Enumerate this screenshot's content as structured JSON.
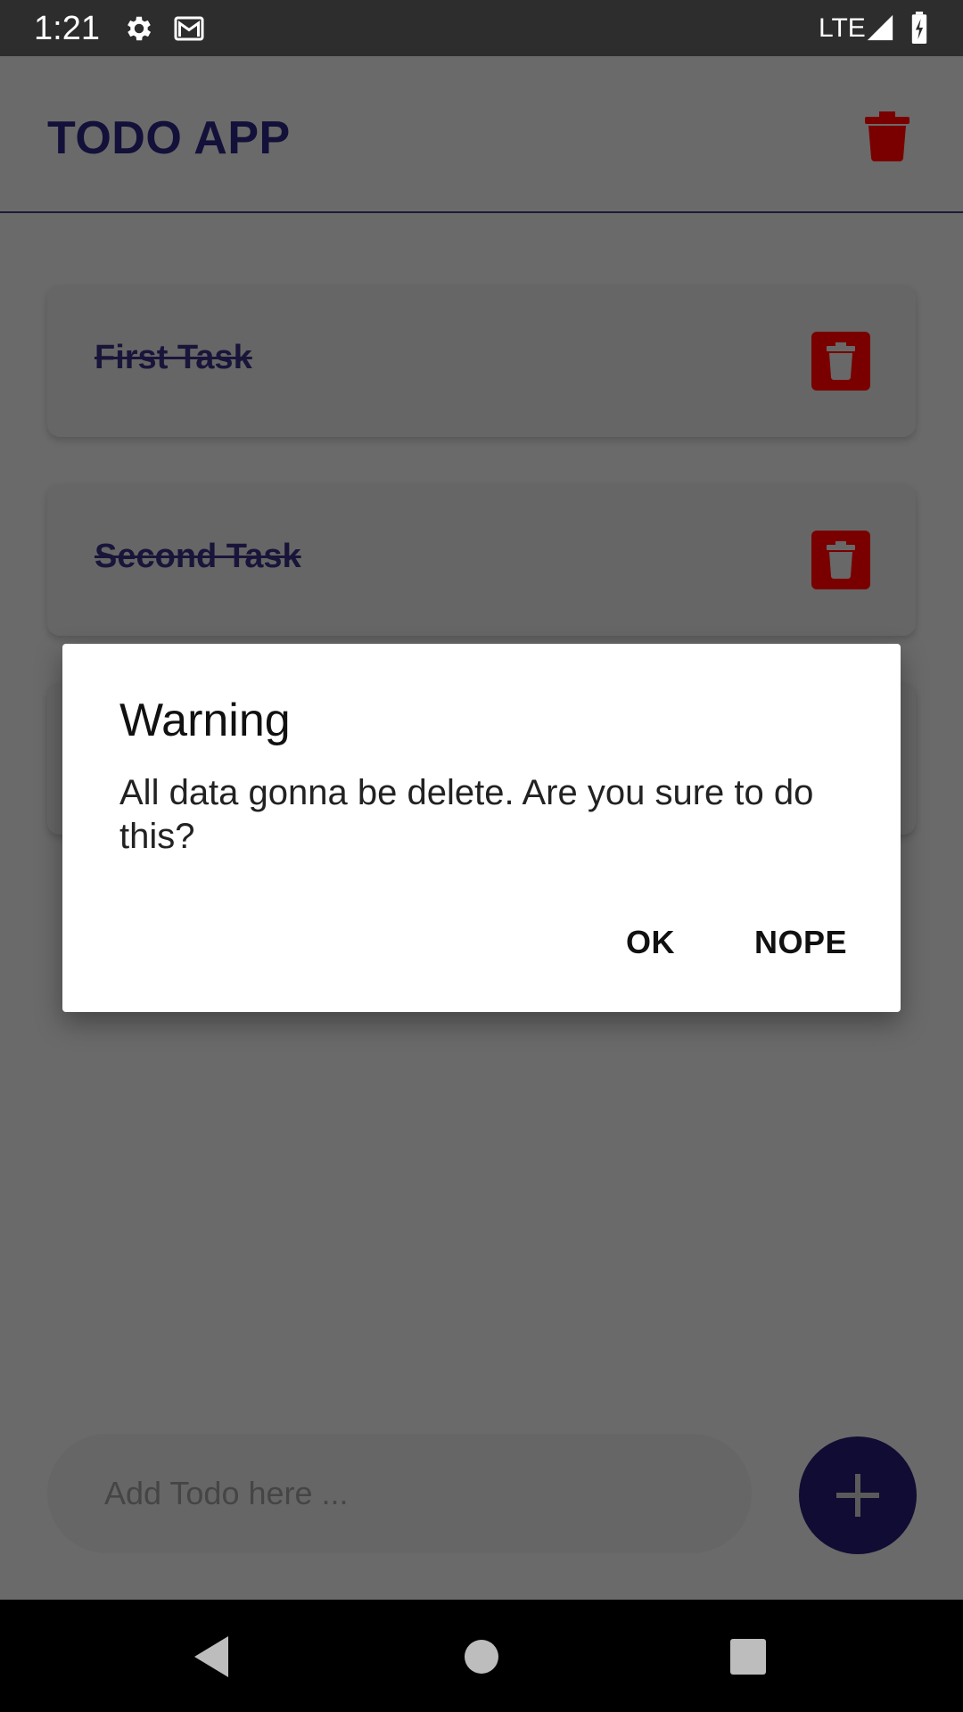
{
  "status_bar": {
    "time": "1:21",
    "network": "LTE",
    "icons": [
      "gear-icon",
      "mail-icon",
      "signal-icon",
      "battery-charging-icon"
    ]
  },
  "app": {
    "title": "TODO APP",
    "header_action_icon": "trash-icon",
    "accent_color": "#13103a",
    "delete_color": "#b00000"
  },
  "todos": [
    {
      "label": "First Task",
      "done": true
    },
    {
      "label": "Second Task",
      "done": true
    },
    {
      "label": "",
      "done": true
    }
  ],
  "add_todo": {
    "placeholder": "Add Todo here ...",
    "fab_icon": "plus-icon"
  },
  "dialog": {
    "title": "Warning",
    "message": "All data gonna be delete. Are you sure to do this?",
    "ok_label": "OK",
    "cancel_label": "NOPE"
  },
  "nav_bar": {
    "icons": [
      "back-icon",
      "home-icon",
      "recents-icon"
    ]
  }
}
